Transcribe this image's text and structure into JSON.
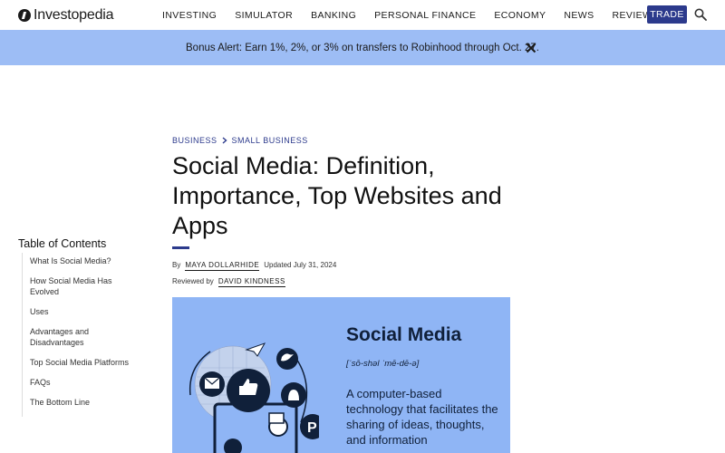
{
  "header": {
    "logo_text": "Investopedia",
    "nav": [
      "INVESTING",
      "SIMULATOR",
      "BANKING",
      "PERSONAL FINANCE",
      "ECONOMY",
      "NEWS",
      "REVIEWS"
    ],
    "trade_label": "TRADE",
    "search_icon": "search-icon"
  },
  "banner": {
    "text": "Bonus Alert: Earn 1%, 2%, or 3% on transfers to Robinhood through Oct. 27.",
    "close_icon": "close-icon"
  },
  "breadcrumb": [
    "BUSINESS",
    "SMALL BUSINESS"
  ],
  "article": {
    "title": "Social Media: Definition, Importance, Top Websites and Apps",
    "by_label": "By",
    "author": "MAYA DOLLARHIDE",
    "updated": "Updated July 31, 2024",
    "reviewed_label": "Reviewed by",
    "reviewer": "DAVID KINDNESS"
  },
  "toc": {
    "title": "Table of Contents",
    "items": [
      "What Is Social Media?",
      "How Social Media Has Evolved",
      "Uses",
      "Advantages and Disadvantages",
      "Top Social Media Platforms",
      "FAQs",
      "The Bottom Line"
    ]
  },
  "hero": {
    "heading": "Social Media",
    "pronunciation": "[ˈsō-shəl ˈmē-dē-ə]",
    "definition": "A computer-based technology that facilitates the sharing of ideas, thoughts, and information"
  },
  "colors": {
    "brand": "#2c3a8c",
    "banner_bg": "#9dbdf5",
    "hero_bg": "#8fb5f5"
  }
}
